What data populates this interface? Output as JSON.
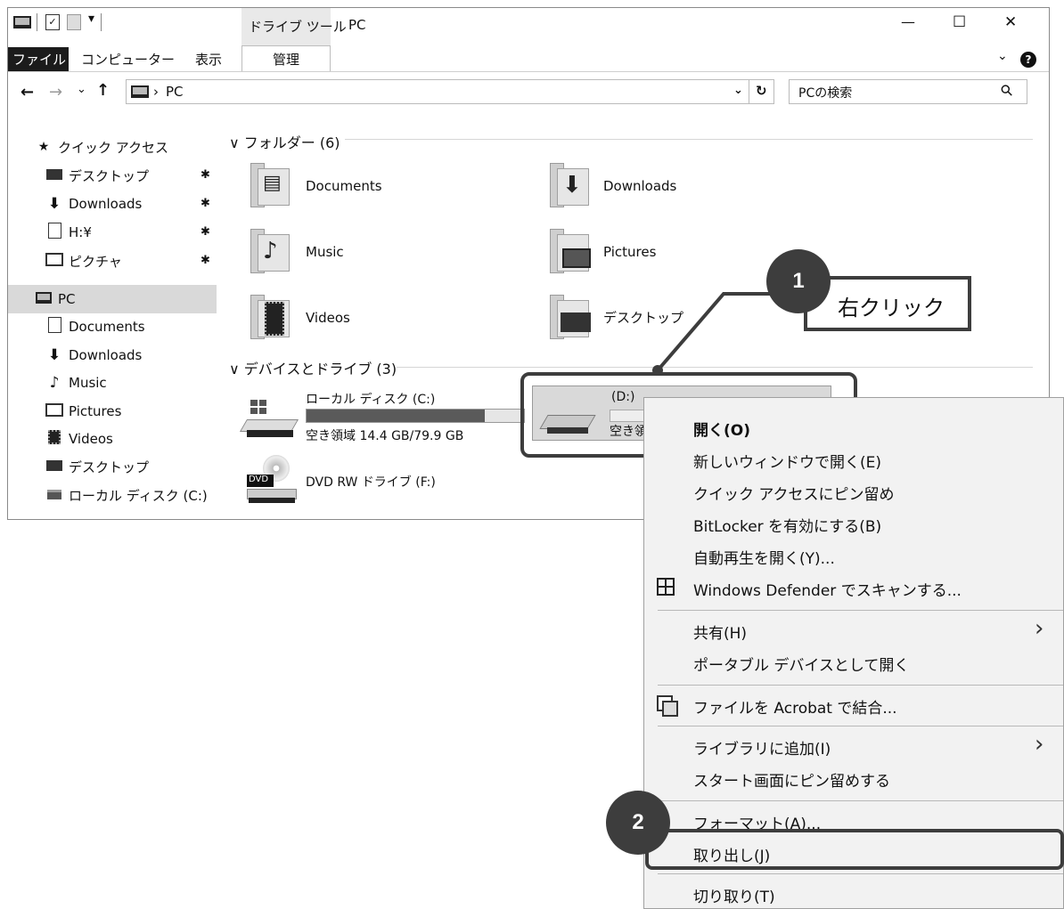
{
  "window": {
    "title": "PC",
    "contextual_tab_group": "ドライブ ツール",
    "qat_chevron": "▾",
    "minimize_glyph": "—",
    "maximize_glyph": "☐",
    "close_glyph": "✕",
    "collapse_ribbon_glyph": "⌄",
    "help_glyph": "?"
  },
  "ribbon": {
    "tabs": [
      {
        "label": "ファイル"
      },
      {
        "label": "コンピューター"
      },
      {
        "label": "表示"
      },
      {
        "label": "管理"
      }
    ]
  },
  "navbar": {
    "back_glyph": "←",
    "forward_glyph": "→",
    "recent_glyph": "⌄",
    "up_glyph": "↑",
    "breadcrumb_separator": "›",
    "breadcrumb": "PC",
    "dropdown_glyph": "⌄",
    "refresh_glyph": "↻",
    "search_placeholder": "PCの検索",
    "search_glyph": "⚲"
  },
  "sidebar": {
    "pin_glyph": "✱",
    "quick_access": "クイック アクセス",
    "quick_items": [
      {
        "label": "デスクトップ",
        "icon": "desktop-icon",
        "pinned": true
      },
      {
        "label": "Downloads",
        "icon": "download-arrow-icon",
        "pinned": true
      },
      {
        "label": "H:¥",
        "icon": "network-drive-icon",
        "pinned": true
      },
      {
        "label": "ピクチャ",
        "icon": "pictures-icon",
        "pinned": true
      }
    ],
    "pc": "PC",
    "pc_items": [
      {
        "label": "Documents",
        "icon": "documents-icon"
      },
      {
        "label": "Downloads",
        "icon": "download-arrow-icon"
      },
      {
        "label": "Music",
        "icon": "music-note-icon"
      },
      {
        "label": "Pictures",
        "icon": "pictures-icon"
      },
      {
        "label": "Videos",
        "icon": "film-icon"
      },
      {
        "label": "デスクトップ",
        "icon": "desktop-icon"
      },
      {
        "label": "ローカル ディスク (C:)",
        "icon": "local-disk-icon"
      }
    ]
  },
  "main": {
    "folders_header": "フォルダー (6)",
    "folders": [
      {
        "label": "Documents",
        "icon": "documents-folder-icon"
      },
      {
        "label": "Downloads",
        "icon": "downloads-folder-icon"
      },
      {
        "label": "Music",
        "icon": "music-folder-icon"
      },
      {
        "label": "Pictures",
        "icon": "pictures-folder-icon"
      },
      {
        "label": "Videos",
        "icon": "videos-folder-icon"
      },
      {
        "label": "デスクトップ",
        "icon": "desktop-folder-icon"
      }
    ],
    "devices_header": "デバイスとドライブ (3)",
    "drives": {
      "c_name": "ローカル ディスク (C:)",
      "c_free": "空き領域 14.4 GB/79.9 GB",
      "c_used_fraction": 0.82,
      "d_name": "(D:)",
      "d_free_partial": "空き領",
      "dvd_name": "DVD RW ドライブ (F:)",
      "dvd_label": "DVD"
    }
  },
  "context_menu": {
    "items": [
      {
        "label": "開く(O)",
        "bold": true
      },
      {
        "label": "新しいウィンドウで開く(E)"
      },
      {
        "label": "クイック アクセスにピン留め"
      },
      {
        "label": "BitLocker を有効にする(B)"
      },
      {
        "label": "自動再生を開く(Y)..."
      },
      {
        "label": "Windows Defender でスキャンする...",
        "icon": "windows-defender-icon"
      },
      {
        "label": "共有(H)",
        "submenu": true
      },
      {
        "label": "ポータブル デバイスとして開く"
      },
      {
        "label": "ファイルを Acrobat で結合...",
        "icon": "acrobat-combine-icon"
      },
      {
        "label": "ライブラリに追加(I)",
        "submenu": true
      },
      {
        "label": "スタート画面にピン留めする"
      },
      {
        "label": "フォーマット(A)..."
      },
      {
        "label": "取り出し(J)"
      },
      {
        "label": "切り取り(T)"
      }
    ],
    "submenu_glyph": "›"
  },
  "annotations": {
    "step1_number": "1",
    "step1_text": "右クリック",
    "step2_number": "2"
  }
}
